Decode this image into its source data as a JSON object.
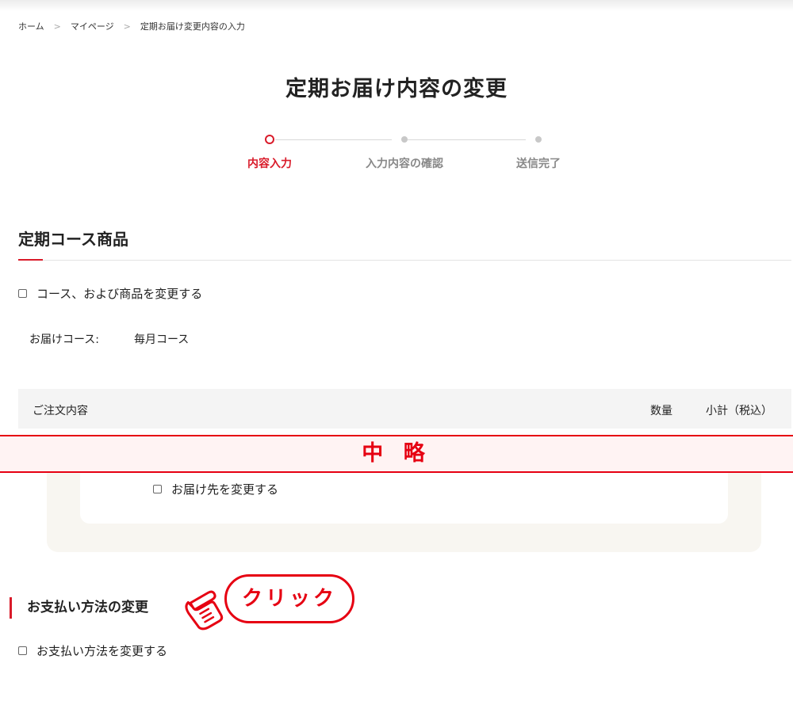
{
  "breadcrumb": {
    "home": "ホーム",
    "mypage": "マイページ",
    "current": "定期お届け変更内容の入力"
  },
  "page_title": "定期お届け内容の変更",
  "stepper": {
    "steps": [
      "内容入力",
      "入力内容の確認",
      "送信完了"
    ],
    "active_index": 0
  },
  "course_section": {
    "heading": "定期コース商品",
    "change_course_label": "コース、および商品を変更する",
    "course_key": "お届けコース:",
    "course_value": "毎月コース"
  },
  "order_table": {
    "col_contents": "ご注文内容",
    "col_qty": "数量",
    "col_subtotal": "小計（税込）"
  },
  "omitted_label": "中 略",
  "delivery": {
    "change_address_label": "お届け先を変更する"
  },
  "payment": {
    "heading": "お支払い方法の変更",
    "change_payment_label": "お支払い方法を変更する"
  },
  "callout": {
    "label": "クリック",
    "icon": "pointing-hand-icon"
  },
  "colors": {
    "accent": "#d91b2a",
    "callout_red": "#e60012",
    "beige": "#f8f6f1"
  }
}
